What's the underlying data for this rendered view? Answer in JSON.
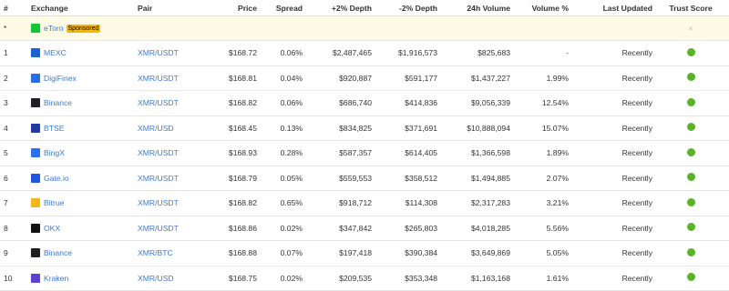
{
  "headers": {
    "num": "#",
    "exchange": "Exchange",
    "pair": "Pair",
    "price": "Price",
    "spread": "Spread",
    "depth_plus": "+2% Depth",
    "depth_minus": "-2% Depth",
    "volume": "24h Volume",
    "volume_pct": "Volume %",
    "last_updated": "Last Updated",
    "trust": "Trust Score"
  },
  "sponsored": {
    "num": "*",
    "exchange": "eToro",
    "badge": "Sponsored",
    "logo_color": "#13c636",
    "close": "×"
  },
  "rows": [
    {
      "num": "1",
      "exchange": "MEXC",
      "logo_color": "#1a61d6",
      "pair": "XMR/USDT",
      "price": "$168.72",
      "spread": "0.06%",
      "depth_plus": "$2,487,465",
      "depth_minus": "$1,916,573",
      "volume": "$825,683",
      "volume_pct": "-",
      "updated": "Recently"
    },
    {
      "num": "2",
      "exchange": "DigiFinex",
      "logo_color": "#2a6de8",
      "pair": "XMR/USDT",
      "price": "$168.81",
      "spread": "0.04%",
      "depth_plus": "$920,887",
      "depth_minus": "$591,177",
      "volume": "$1,437,227",
      "volume_pct": "1.99%",
      "updated": "Recently"
    },
    {
      "num": "3",
      "exchange": "Binance",
      "logo_color": "#1e2026",
      "pair": "XMR/USDT",
      "price": "$168.82",
      "spread": "0.06%",
      "depth_plus": "$686,740",
      "depth_minus": "$414,836",
      "volume": "$9,056,339",
      "volume_pct": "12.54%",
      "updated": "Recently"
    },
    {
      "num": "4",
      "exchange": "BTSE",
      "logo_color": "#1f3aa5",
      "pair": "XMR/USD",
      "price": "$168.45",
      "spread": "0.13%",
      "depth_plus": "$834,825",
      "depth_minus": "$371,691",
      "volume": "$10,888,094",
      "volume_pct": "15.07%",
      "updated": "Recently"
    },
    {
      "num": "5",
      "exchange": "BingX",
      "logo_color": "#2b6ff2",
      "pair": "XMR/USDT",
      "price": "$168.93",
      "spread": "0.28%",
      "depth_plus": "$587,357",
      "depth_minus": "$614,405",
      "volume": "$1,366,598",
      "volume_pct": "1.89%",
      "updated": "Recently"
    },
    {
      "num": "6",
      "exchange": "Gate.io",
      "logo_color": "#2354e6",
      "pair": "XMR/USDT",
      "price": "$168.79",
      "spread": "0.05%",
      "depth_plus": "$559,553",
      "depth_minus": "$358,512",
      "volume": "$1,494,885",
      "volume_pct": "2.07%",
      "updated": "Recently"
    },
    {
      "num": "7",
      "exchange": "Bitrue",
      "logo_color": "#f2b51c",
      "pair": "XMR/USDT",
      "price": "$168.82",
      "spread": "0.65%",
      "depth_plus": "$918,712",
      "depth_minus": "$114,308",
      "volume": "$2,317,283",
      "volume_pct": "3.21%",
      "updated": "Recently"
    },
    {
      "num": "8",
      "exchange": "OKX",
      "logo_color": "#111111",
      "pair": "XMR/USDT",
      "price": "$168.86",
      "spread": "0.02%",
      "depth_plus": "$347,842",
      "depth_minus": "$265,803",
      "volume": "$4,018,285",
      "volume_pct": "5.56%",
      "updated": "Recently"
    },
    {
      "num": "9",
      "exchange": "Binance",
      "logo_color": "#1e2026",
      "pair": "XMR/BTC",
      "price": "$168.88",
      "spread": "0.07%",
      "depth_plus": "$197,418",
      "depth_minus": "$390,384",
      "volume": "$3,649,869",
      "volume_pct": "5.05%",
      "updated": "Recently"
    },
    {
      "num": "10",
      "exchange": "Kraken",
      "logo_color": "#5741d9",
      "pair": "XMR/USD",
      "price": "$168.75",
      "spread": "0.02%",
      "depth_plus": "$209,535",
      "depth_minus": "$353,348",
      "volume": "$1,163,168",
      "volume_pct": "1.61%",
      "updated": "Recently"
    }
  ],
  "trust_color": "#5ab228"
}
